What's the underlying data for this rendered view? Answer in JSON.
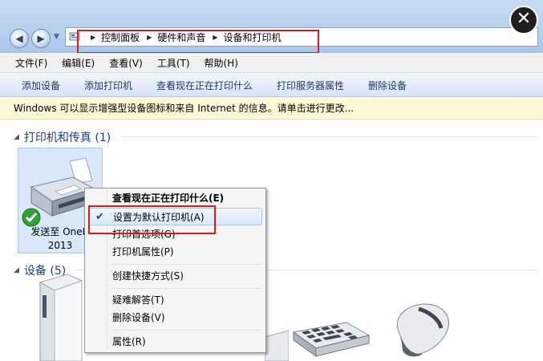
{
  "window": {
    "breadcrumbs": [
      "控制面板",
      "硬件和声音",
      "设备和打印机"
    ],
    "close_glyph": "✕"
  },
  "menubar": [
    "文件(F)",
    "编辑(E)",
    "查看(V)",
    "工具(T)",
    "帮助(H)"
  ],
  "commands": [
    "添加设备",
    "添加打印机",
    "查看现在正在打印什么",
    "打印服务器属性",
    "删除设备"
  ],
  "infobar": "Windows 可以显示增强型设备图标和来自 Internet 的信息。请单击进行更改...",
  "groups": {
    "printers": {
      "label": "打印机和传真 (1)"
    },
    "devices": {
      "label": "设备 (5)"
    }
  },
  "printer_tile": {
    "label_line1": "发送至 OneN",
    "label_line2": "2013",
    "status": "default"
  },
  "context_menu": {
    "items": [
      {
        "label": "查看现在正在打印什么(E)",
        "bold": true
      },
      {
        "label": "设置为默认打印机(A)",
        "checked": true,
        "selected": true
      },
      {
        "label": "打印首选项(G)"
      },
      {
        "label": "打印机属性(P)"
      },
      {
        "label": "创建快捷方式(S)"
      },
      {
        "label": "疑难解答(T)"
      },
      {
        "label": "删除设备(V)"
      },
      {
        "label": "属性(R)"
      }
    ]
  },
  "icons": {
    "back": "back-arrow-icon",
    "forward": "forward-arrow-icon",
    "printer": "printer-icon",
    "default_check": "green-check-icon",
    "drive": "external-drive-icon",
    "keyboard": "keyboard-icon",
    "mouse": "mouse-icon"
  },
  "colors": {
    "highlight": "#e01919",
    "group_header": "#1c3c8c",
    "command_text": "#1e3965"
  }
}
